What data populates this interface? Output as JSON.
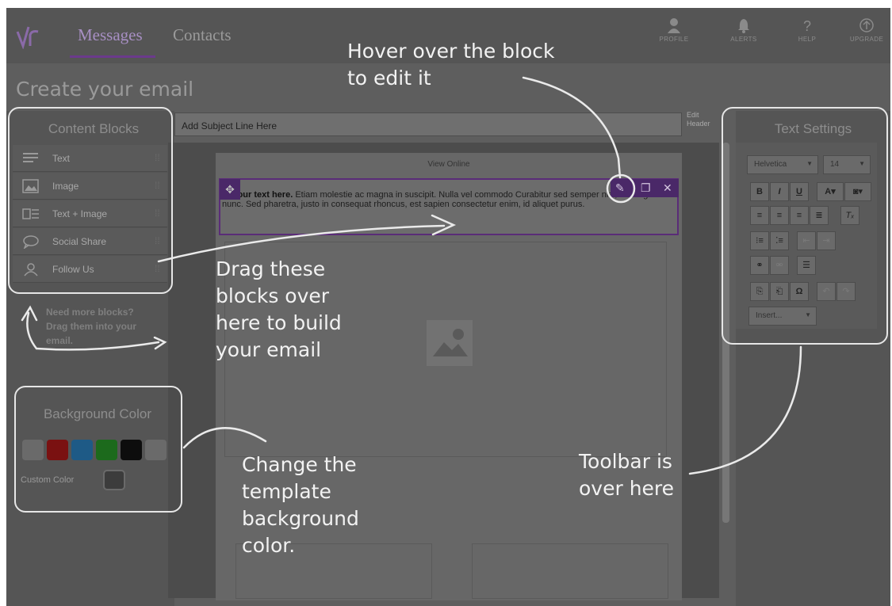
{
  "nav": {
    "tabs": [
      "Messages",
      "Contacts"
    ],
    "right": [
      {
        "label": "PROFILE",
        "icon": "profile-icon"
      },
      {
        "label": "ALERTS",
        "icon": "bell-icon"
      },
      {
        "label": "HELP",
        "icon": "help-icon"
      },
      {
        "label": "UPGRADE",
        "icon": "upgrade-icon"
      }
    ]
  },
  "page": {
    "title": "Create your email"
  },
  "content_blocks": {
    "title": "Content Blocks",
    "items": [
      {
        "label": "Text",
        "icon": "text-lines-icon"
      },
      {
        "label": "Image",
        "icon": "image-icon"
      },
      {
        "label": "Text + Image",
        "icon": "text-image-icon"
      },
      {
        "label": "Social Share",
        "icon": "speech-bubble-icon"
      },
      {
        "label": "Follow Us",
        "icon": "person-icon"
      }
    ],
    "hint": "Need more blocks? Drag them into your email."
  },
  "background": {
    "title": "Background Color",
    "swatches": [
      "#6a6a6a",
      "#7a1111",
      "#1e5a86",
      "#1c6a1c",
      "#0d0d0d",
      "#6a6a6a"
    ],
    "custom_label": "Custom Color"
  },
  "editor": {
    "subject_placeholder": "Add Subject Line Here",
    "edit_header": "Edit Header",
    "view_online": "View Online",
    "text_bold": "er your text here.",
    "text_body": " Etiam molestie ac magna in suscipit. Nulla vel commodo Curabitur sed semper nisl, non dignissim nunc. Sed pharetra, justo in consequat rhoncus, est sapien consectetur enim, id aliquet purus."
  },
  "text_settings": {
    "title": "Text Settings",
    "font": "Helvetica",
    "size": "14",
    "insert": "Insert..."
  },
  "annotations": {
    "hover": "Hover over the block to edit it",
    "drag": "Drag these blocks over here to build your email",
    "change": "Change the template background color.",
    "toolbar": "Toolbar is over here"
  }
}
